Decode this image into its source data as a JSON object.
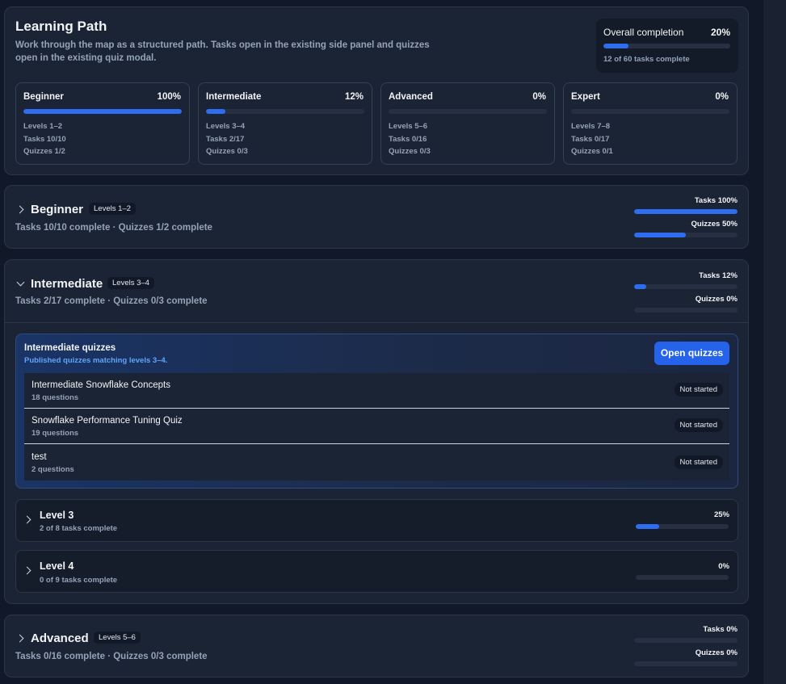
{
  "header": {
    "title": "Learning Path",
    "subtitle": "Work through the map as a structured path. Tasks open in the existing side panel and quizzes open in the existing quiz modal.",
    "overall": {
      "label": "Overall completion",
      "percent_label": "20%",
      "percent": 20,
      "count": "12 of 60 tasks complete"
    }
  },
  "tiers": [
    {
      "name": "Beginner",
      "percent_label": "100%",
      "percent": 100,
      "levels": "Levels 1–2",
      "tasks": "Tasks 10/10",
      "quizzes": "Quizzes 1/2"
    },
    {
      "name": "Intermediate",
      "percent_label": "12%",
      "percent": 12,
      "levels": "Levels 3–4",
      "tasks": "Tasks 2/17",
      "quizzes": "Quizzes 0/3"
    },
    {
      "name": "Advanced",
      "percent_label": "0%",
      "percent": 0,
      "levels": "Levels 5–6",
      "tasks": "Tasks 0/16",
      "quizzes": "Quizzes 0/3"
    },
    {
      "name": "Expert",
      "percent_label": "0%",
      "percent": 0,
      "levels": "Levels 7–8",
      "tasks": "Tasks 0/17",
      "quizzes": "Quizzes 0/1"
    }
  ],
  "sections": {
    "beginner": {
      "title": "Beginner",
      "badge": "Levels 1–2",
      "summary": "Tasks 10/10 complete · Quizzes 1/2 complete",
      "tasks_label": "Tasks 100%",
      "tasks_percent": 100,
      "quizzes_label": "Quizzes 50%",
      "quizzes_percent": 50
    },
    "intermediate": {
      "title": "Intermediate",
      "badge": "Levels 3–4",
      "summary": "Tasks 2/17 complete · Quizzes 0/3 complete",
      "tasks_label": "Tasks 12%",
      "tasks_percent": 12,
      "quizzes_label": "Quizzes 0%",
      "quizzes_percent": 0,
      "quiz_panel": {
        "title": "Intermediate quizzes",
        "subtitle": "Published quizzes matching levels 3–4.",
        "open_button": "Open quizzes",
        "quizzes": [
          {
            "name": "Intermediate Snowflake Concepts",
            "count": "18 questions",
            "status": "Not started"
          },
          {
            "name": "Snowflake Performance Tuning Quiz",
            "count": "19 questions",
            "status": "Not started"
          },
          {
            "name": "test",
            "count": "2 questions",
            "status": "Not started"
          }
        ]
      },
      "levels": [
        {
          "name": "Level 3",
          "summary": "2 of 8 tasks complete",
          "percent_label": "25%",
          "percent": 25
        },
        {
          "name": "Level 4",
          "summary": "0 of 9 tasks complete",
          "percent_label": "0%",
          "percent": 0
        }
      ]
    },
    "advanced": {
      "title": "Advanced",
      "badge": "Levels 5–6",
      "summary": "Tasks 0/16 complete · Quizzes 0/3 complete",
      "tasks_label": "Tasks 0%",
      "tasks_percent": 0,
      "quizzes_label": "Quizzes 0%",
      "quizzes_percent": 0
    }
  },
  "colors": {
    "accent": "#2563eb",
    "background": "#111827",
    "card": "#1b2434",
    "muted_text": "#94a3b8"
  }
}
